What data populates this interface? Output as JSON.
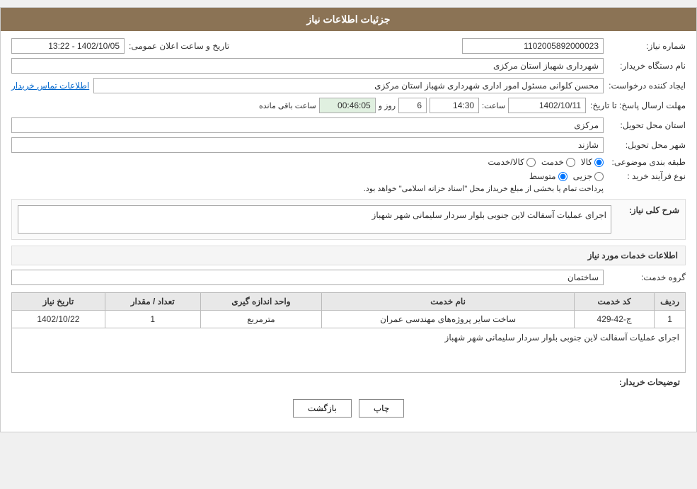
{
  "header": {
    "title": "جزئیات اطلاعات نیاز"
  },
  "fields": {
    "shomara_niaz_label": "شماره نیاز:",
    "shomara_niaz_value": "1102005892000023",
    "name_dastgah_label": "نام دستگاه خریدار:",
    "name_dastgah_value": "شهرداری شهباز استان مرکزی",
    "ijad_konande_label": "ایجاد کننده درخواست:",
    "ijad_konande_value": "محسن کلوانی مسئول امور اداری شهرداری شهباز استان مرکزی",
    "ijad_konande_link": "اطلاعات تماس خریدار",
    "mohlat_label": "مهلت ارسال پاسخ: تا تاریخ:",
    "mohlat_date": "1402/10/11",
    "mohlat_saat_label": "ساعت:",
    "mohlat_saat": "14:30",
    "mohlat_roz_label": "روز و",
    "mohlat_roz": "6",
    "mohlat_mande_label": "ساعت باقی مانده",
    "mohlat_mande": "00:46:05",
    "ostan_tahvil_label": "استان محل تحویل:",
    "ostan_tahvil_value": "مرکزی",
    "shahr_tahvil_label": "شهر محل تحویل:",
    "shahr_tahvil_value": "شازند",
    "tabaqe_label": "طبقه بندی موضوعی:",
    "tabaqe_options": [
      "کالا",
      "خدمت",
      "کالا/خدمت"
    ],
    "tabaqe_selected": "کالا",
    "nooe_farayand_label": "نوع فرآیند خرید :",
    "nooe_farayand_options": [
      "جزیی",
      "متوسط"
    ],
    "nooe_farayand_note": "پرداخت تمام یا بخشی از مبلغ خریداز محل \"اسناد خزانه اسلامی\" خواهد بود.",
    "tarikh_aalan_label": "تاریخ و ساعت اعلان عمومی:",
    "tarikh_aalan_value": "1402/10/05 - 13:22",
    "sharh_label": "شرح کلی نیاز:",
    "sharh_value": "اجرای عملیات آسفالت لاین جنوبی بلوار سردار سلیمانی شهر شهباز",
    "khadamat_title": "اطلاعات خدمات مورد نیاز",
    "grooh_khadamat_label": "گروه خدمت:",
    "grooh_khadamat_value": "ساختمان",
    "table": {
      "headers": [
        "ردیف",
        "کد خدمت",
        "نام خدمت",
        "واحد اندازه گیری",
        "تعداد / مقدار",
        "تاریخ نیاز"
      ],
      "rows": [
        {
          "radif": "1",
          "code": "ج-42-429",
          "name": "ساخت سایر پروژه‌های مهندسی عمران",
          "unit": "مترمربع",
          "tedad": "1",
          "tarikh": "1402/10/22"
        }
      ]
    },
    "tozihat_label": "توضیحات خریدار:",
    "tozihat_value": "اجرای عملیات آسفالت لاین جنوبی بلوار سردار سلیمانی شهر شهباز"
  },
  "buttons": {
    "print_label": "چاپ",
    "back_label": "بازگشت"
  }
}
